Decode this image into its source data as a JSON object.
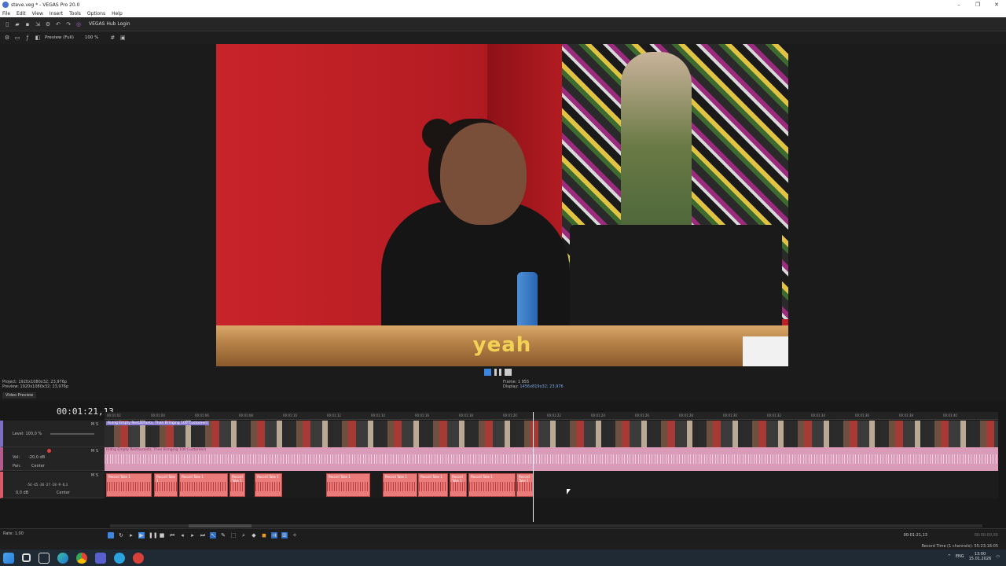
{
  "window": {
    "title": "steve.veg * - VEGAS Pro 20.0",
    "controls": [
      "–",
      "❐",
      "✕"
    ]
  },
  "menu": [
    "File",
    "Edit",
    "View",
    "Insert",
    "Tools",
    "Options",
    "Help"
  ],
  "toolbar": {
    "hub_login": "VEGAS Hub Login"
  },
  "preview_toolbar": {
    "quality": "Preview (Full)",
    "zoom": "100 %"
  },
  "preview": {
    "subtitle": "yeah",
    "project_info": "Project:   1920x1080x32; 23,976p",
    "preview_info": "Preview:  1920x1080x32; 23,976p",
    "frame_label": "Frame:   1 955",
    "display_label": "Display:",
    "display_value": "1456x819x32; 23,976",
    "tab": "Video Preview"
  },
  "timeline": {
    "time_code": "00:01:21,13",
    "ruler_marks": [
      "00:01:02",
      "00:01:04",
      "00:01:06",
      "00:01:08",
      "00:01:10",
      "00:01:12",
      "00:01:14",
      "00:01:16",
      "00:01:18",
      "00:01:20",
      "00:01:22",
      "00:01:24",
      "00:01:26",
      "00:01:28",
      "00:01:30",
      "00:01:32",
      "00:01:34",
      "00:01:36",
      "00:01:38",
      "00:01:40"
    ],
    "video_track": {
      "level": "Level: 100,0 %",
      "clip_label": "Ridng Empty Restaurants, Then Bringing 100 Customers"
    },
    "audio_track1": {
      "vol": "Vol:",
      "vol_value": "-20,0 dB",
      "pan": "Pan:",
      "pan_value": "Center",
      "clip_label": "Ridng Empty Restaurants, Then Bringing 100 Customers"
    },
    "audio_track2": {
      "db": "0,0 dB",
      "pan_value": "Center",
      "levels": "-54 -45 -36 -27 -18 -9 -6,3"
    },
    "clips": [
      "Record Take 1",
      "Record Take 1",
      "Record Take 1",
      "Record Take 1",
      "Record Take 1",
      "Record Take 1",
      "Record Take 1",
      "Record Take 1",
      "Record Take 1",
      "Record Take 1",
      "Record Take 1"
    ],
    "ms": "M  S"
  },
  "bottom": {
    "rate": "Rate: 1,00",
    "cursor_time": "00:01:21,13",
    "end_time": "00:00:00,00",
    "record_time": "Record Time (1 channels): 55:23:18:05"
  },
  "taskbar": {
    "lang": "ENG",
    "time": "13:00",
    "date": "15.01.2026"
  }
}
